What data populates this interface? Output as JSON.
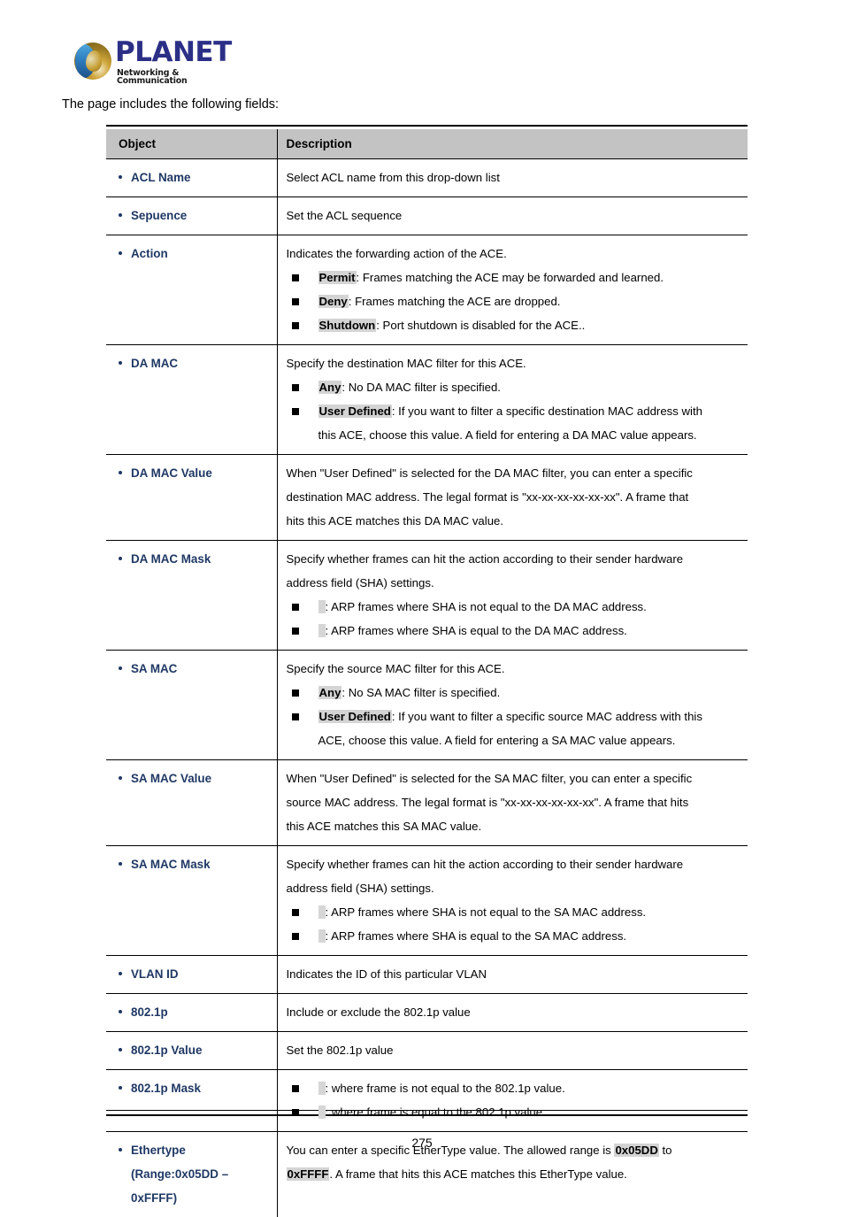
{
  "logo": {
    "wordmark": "PLANET",
    "tagline": "Networking & Communication",
    "globe_icon": "planet-globe-icon"
  },
  "intro_text": "The page includes the following fields:",
  "page_number": "275",
  "colors": {
    "label_navy": "#1f3864",
    "header_gray": "#c3c3c3",
    "highlight_gray": "#d4d4d4"
  },
  "table": {
    "headers": {
      "object": "Object",
      "description": "Description"
    },
    "rows": [
      {
        "label": "ACL Name",
        "label_extra": [],
        "desc_lead": "Select ACL name from this drop-down list",
        "bullets": []
      },
      {
        "label": "Sepuence",
        "label_extra": [],
        "desc_lead": "Set the ACL sequence",
        "bullets": []
      },
      {
        "label": "Action",
        "label_extra": [],
        "desc_lead": "Indicates the forwarding action of the ACE.",
        "bullets": [
          {
            "key": "Permit",
            "text": ": Frames matching the ACE may be forwarded and learned.",
            "cont": ""
          },
          {
            "key": "Deny",
            "text": ": Frames matching the ACE are dropped.",
            "cont": ""
          },
          {
            "key": "Shutdown",
            "text": ": Port shutdown is disabled for the ACE..",
            "cont": ""
          }
        ]
      },
      {
        "label": "DA MAC",
        "label_extra": [],
        "desc_lead": "Specify the destination MAC filter for this ACE.",
        "bullets": [
          {
            "key": "Any",
            "text": ": No DA MAC filter is specified.",
            "cont": ""
          },
          {
            "key": "User Defined",
            "text": ": If you want to filter a specific destination MAC address with",
            "cont": "this ACE, choose this value. A field for entering a DA MAC value appears."
          }
        ]
      },
      {
        "label": "DA MAC Value",
        "label_extra": [],
        "desc_lead": "When \"User Defined\" is selected for the DA MAC filter, you can enter a specific",
        "desc_lines": [
          "destination MAC address. The legal format is \"xx-xx-xx-xx-xx-xx\". A frame that",
          "hits this ACE matches this DA MAC value."
        ],
        "bullets": []
      },
      {
        "label": "DA MAC Mask",
        "label_extra": [],
        "desc_lead": "Specify whether frames can hit the action according to their sender hardware",
        "desc_lines": [
          "address field (SHA) settings."
        ],
        "bullets": [
          {
            "key": "",
            "text": ": ARP frames where SHA is not equal to the DA MAC address.",
            "cont": ""
          },
          {
            "key": "",
            "text": ": ARP frames where SHA is equal to the DA MAC address.",
            "cont": ""
          }
        ]
      },
      {
        "label": "SA MAC",
        "label_extra": [],
        "desc_lead": "Specify the source MAC filter for this ACE.",
        "bullets": [
          {
            "key": "Any",
            "text": ": No SA MAC filter is specified.",
            "cont": ""
          },
          {
            "key": "User Defined",
            "text": ": If you want to filter a specific source MAC address with this",
            "cont": "ACE, choose this value. A field for entering a SA MAC value appears."
          }
        ]
      },
      {
        "label": "SA MAC Value",
        "label_extra": [],
        "desc_lead": "When \"User Defined\" is selected for the SA MAC filter, you can enter a specific",
        "desc_lines": [
          "source MAC address. The legal format is \"xx-xx-xx-xx-xx-xx\". A frame that hits",
          "this ACE matches this SA MAC value."
        ],
        "bullets": []
      },
      {
        "label": "SA MAC Mask",
        "label_extra": [],
        "desc_lead": "Specify whether frames can hit the action according to their sender hardware",
        "desc_lines": [
          "address field (SHA) settings."
        ],
        "bullets": [
          {
            "key": "",
            "text": ": ARP frames where SHA is not equal to the SA MAC address.",
            "cont": ""
          },
          {
            "key": "",
            "text": ": ARP frames where SHA is equal to the SA MAC address.",
            "cont": ""
          }
        ]
      },
      {
        "label": "VLAN ID",
        "label_extra": [],
        "desc_lead": "Indicates the ID of this particular VLAN",
        "bullets": []
      },
      {
        "label": "802.1p",
        "label_extra": [],
        "desc_lead": "Include or exclude the 802.1p value",
        "bullets": []
      },
      {
        "label": "802.1p Value",
        "label_extra": [],
        "desc_lead": "Set the 802.1p value",
        "bullets": []
      },
      {
        "label": "802.1p Mask",
        "label_extra": [],
        "desc_lead": "",
        "bullets": [
          {
            "key": "",
            "text": ": where frame is not equal to the 802.1p value.",
            "cont": ""
          },
          {
            "key": "",
            "text": ": where frame is equal to the 802.1p value.",
            "cont": ""
          }
        ]
      },
      {
        "label": "Ethertype",
        "label_extra": [
          "(Range:0x05DD –",
          "0xFFFF)"
        ],
        "desc_lead": "",
        "ethertype": {
          "pre": "You can enter a specific EtherType value. The allowed range is ",
          "low": "0x05DD",
          "mid": " to",
          "high": "0xFFFF",
          "post": ". A frame that hits this ACE matches this EtherType value."
        },
        "bullets": []
      }
    ]
  }
}
